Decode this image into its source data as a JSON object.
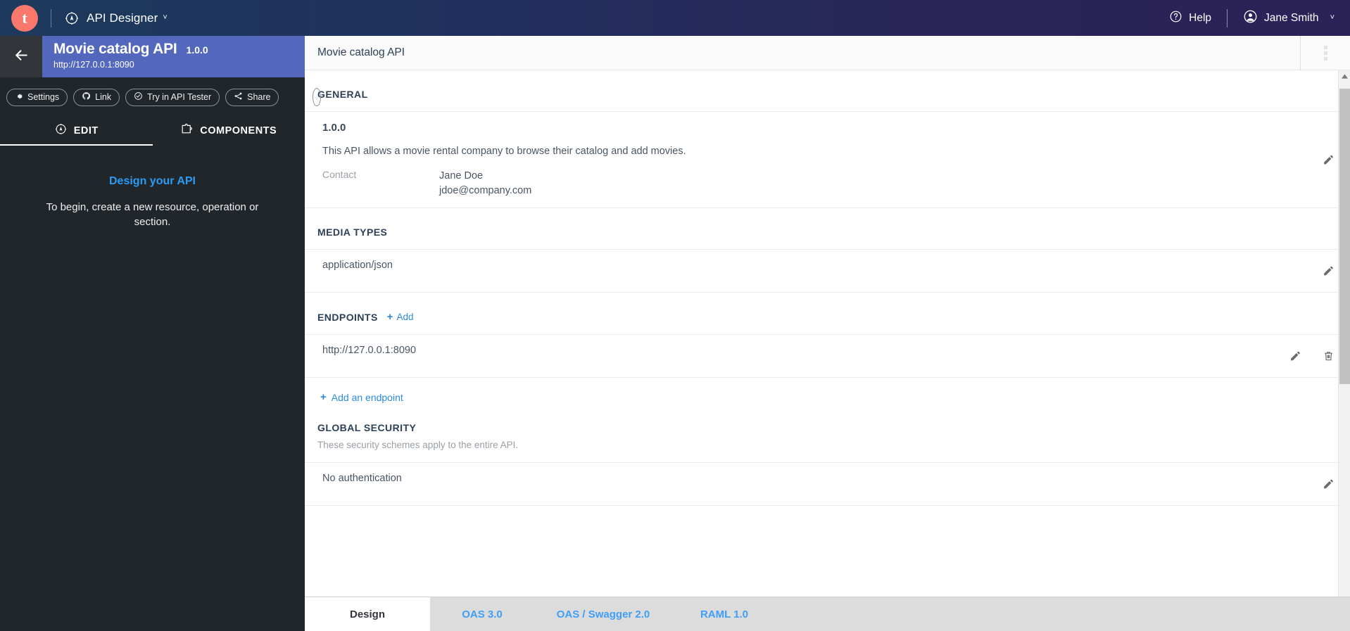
{
  "topbar": {
    "logo_letter": "t",
    "logo_color": "#f9786b",
    "compass_icon": "compass-icon",
    "app_name": "API Designer",
    "caret": "˅",
    "help_label": "Help",
    "help_icon": "help-circle-icon",
    "user_name": "Jane Smith",
    "user_icon": "user-circle-icon",
    "user_caret": "˅"
  },
  "sidebar": {
    "back_icon": "back-arrow-icon",
    "api_title": "Movie catalog API",
    "api_version": "1.0.0",
    "api_url": "http://127.0.0.1:8090",
    "pills": [
      {
        "label": "Settings",
        "icon": "gear-icon"
      },
      {
        "label": "Link",
        "icon": "link-github-icon"
      },
      {
        "label": "Try in API Tester",
        "icon": "check-circle-icon"
      },
      {
        "label": "Share",
        "icon": "share-icon"
      }
    ],
    "add_button": "+",
    "tabs": [
      {
        "label": "EDIT",
        "icon": "compass-icon",
        "active": true
      },
      {
        "label": "COMPONENTS",
        "icon": "puzzle-icon",
        "active": false
      }
    ],
    "empty_heading": "Design your API",
    "empty_text": "To begin, create a new resource, operation or section."
  },
  "main": {
    "header_title": "Movie catalog API",
    "kebab_icon": "more-vertical-icon",
    "sections": {
      "general": {
        "title": "GENERAL",
        "version": "1.0.0",
        "description": "This API allows a movie rental company to browse their catalog and add movies.",
        "contact_label": "Contact",
        "contact_name": "Jane Doe",
        "contact_email": "jdoe@company.com",
        "edit_icon": "pencil-icon"
      },
      "media_types": {
        "title": "MEDIA TYPES",
        "value": "application/json",
        "edit_icon": "pencil-icon"
      },
      "endpoints": {
        "title": "ENDPOINTS",
        "add_label": "Add",
        "add_plus": "+",
        "value": "http://127.0.0.1:8090",
        "edit_icon": "pencil-icon",
        "delete_icon": "trash-icon",
        "add_endpoint_label": "Add an endpoint",
        "add_endpoint_plus": "+"
      },
      "global_security": {
        "title": "GLOBAL SECURITY",
        "subtitle": "These security schemes apply to the entire API.",
        "value": "No authentication",
        "edit_icon": "pencil-icon"
      }
    }
  },
  "bottom_tabs": [
    {
      "label": "Design",
      "active": true
    },
    {
      "label": "OAS 3.0",
      "active": false
    },
    {
      "label": "OAS / Swagger 2.0",
      "active": false
    },
    {
      "label": "RAML 1.0",
      "active": false
    }
  ]
}
